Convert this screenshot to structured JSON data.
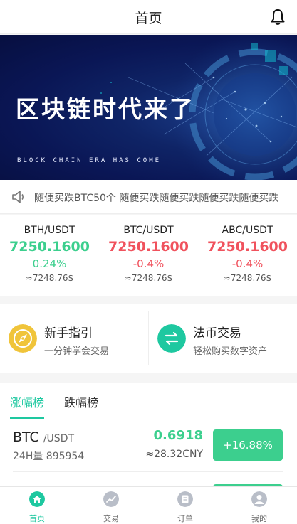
{
  "header": {
    "title": "首页"
  },
  "banner": {
    "title": "区块链时代来了",
    "subtitle": "BLOCK CHAIN ERA HAS COME"
  },
  "notice": {
    "text": "随便买跌BTC50个 随便买跌随便买跌随便买跌随便买跌"
  },
  "tickers": [
    {
      "pair": "BTH/USDT",
      "price": "7250.1600",
      "change": "0.24%",
      "fiat": "≈7248.76$",
      "trend": "up"
    },
    {
      "pair": "BTC/USDT",
      "price": "7250.1600",
      "change": "-0.4%",
      "fiat": "≈7248.76$",
      "trend": "down"
    },
    {
      "pair": "ABC/USDT",
      "price": "7250.1600",
      "change": "-0.4%",
      "fiat": "≈7248.76$",
      "trend": "down"
    }
  ],
  "guides": [
    {
      "title": "新手指引",
      "subtitle": "一分钟学会交易",
      "icon": "compass-icon",
      "color": "#f0c43a"
    },
    {
      "title": "法币交易",
      "subtitle": "轻松购买数字资产",
      "icon": "exchange-arrows-icon",
      "color": "#1ec8a0"
    }
  ],
  "market": {
    "tabs": [
      "涨幅榜",
      "跌幅榜"
    ],
    "rows": [
      {
        "symbol": "BTC",
        "quote": "/USDT",
        "volume": "24H量 895954",
        "price": "0.6918",
        "cny": "≈28.32CNY",
        "change": "+16.88%"
      }
    ]
  },
  "tabbar": [
    {
      "label": "首页",
      "icon": "home-icon",
      "active": true
    },
    {
      "label": "交易",
      "icon": "chart-icon",
      "active": false
    },
    {
      "label": "订单",
      "icon": "order-icon",
      "active": false
    },
    {
      "label": "我的",
      "icon": "user-icon",
      "active": false
    }
  ],
  "colors": {
    "accent": "#1ec8a0",
    "up": "#3ccf8e",
    "down": "#f0525d"
  }
}
